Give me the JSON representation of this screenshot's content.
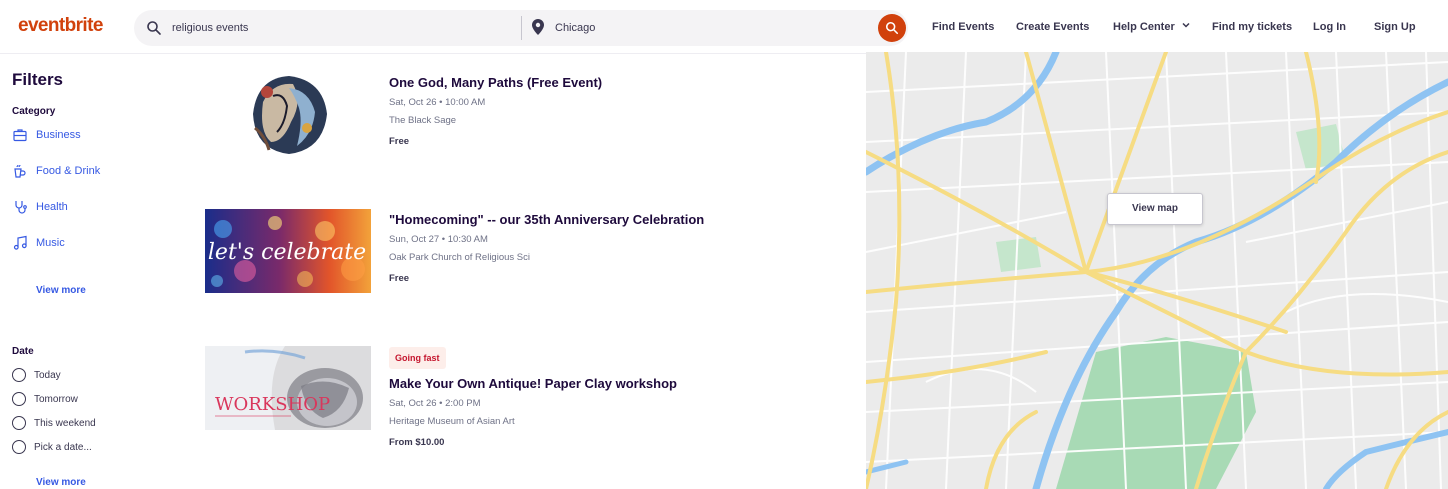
{
  "header": {
    "logo": "eventbrite",
    "search_query": "religious events",
    "location": "Chicago",
    "nav": {
      "find_events": "Find Events",
      "create_events": "Create Events",
      "help_center": "Help Center",
      "find_tickets": "Find my tickets",
      "log_in": "Log In",
      "sign_up": "Sign Up"
    }
  },
  "filters": {
    "title": "Filters",
    "category_label": "Category",
    "categories": [
      {
        "label": "Business",
        "icon": "briefcase-icon"
      },
      {
        "label": "Food & Drink",
        "icon": "food-drink-icon"
      },
      {
        "label": "Health",
        "icon": "health-icon"
      },
      {
        "label": "Music",
        "icon": "music-note-icon"
      }
    ],
    "category_view_more": "View more",
    "date_label": "Date",
    "date_options": [
      "Today",
      "Tomorrow",
      "This weekend",
      "Pick a date..."
    ],
    "date_view_more": "View more"
  },
  "events": [
    {
      "title": "One God, Many Paths (Free Event)",
      "date": "Sat, Oct 26 • 10:00 AM",
      "venue": "The Black Sage",
      "price": "Free"
    },
    {
      "title": "\"Homecoming\" -- our 35th Anniversary Celebration",
      "date": "Sun, Oct 27 • 10:30 AM",
      "venue": "Oak Park Church of Religious Sci",
      "price": "Free",
      "image_text": "let's celebrate"
    },
    {
      "badge": "Going fast",
      "title": "Make Your Own Antique! Paper Clay workshop",
      "date": "Sat, Oct 26 • 2:00 PM",
      "venue": "Heritage Museum of Asian Art",
      "price": "From $10.00",
      "image_text": "WORKSHOP"
    }
  ],
  "map": {
    "view_map_label": "View map"
  },
  "colors": {
    "brand": "#d1410c",
    "link": "#3659e3",
    "badge_bg": "#fdeeea",
    "badge_text": "#c5162e",
    "map_road": "#f6dc83",
    "map_water": "#8ec3f2",
    "map_park": "#a8dab5"
  }
}
